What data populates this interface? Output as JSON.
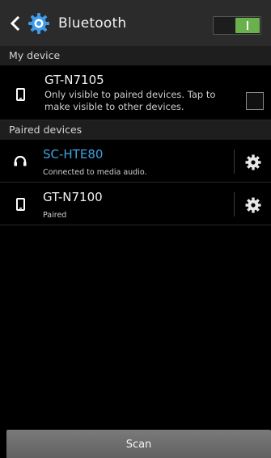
{
  "header": {
    "title": "Bluetooth",
    "back_icon": "chevron-left-icon",
    "app_icon": "settings-gear-icon",
    "toggle_state": "on",
    "toggle_color": "#6ab04c"
  },
  "my_device": {
    "section_label": "My device",
    "name": "GT-N7105",
    "description": "Only visible to paired devices. Tap to make visible to other devices.",
    "visible_checked": false,
    "icon": "phone-icon"
  },
  "paired": {
    "section_label": "Paired devices",
    "devices": [
      {
        "name": "SC-HTE80",
        "status": "Connected to media audio.",
        "icon": "headphones-icon",
        "accent": "#3fa2e0"
      },
      {
        "name": "GT-N7100",
        "status": "Paired",
        "icon": "phone-icon"
      }
    ]
  },
  "footer": {
    "scan_label": "Scan"
  }
}
